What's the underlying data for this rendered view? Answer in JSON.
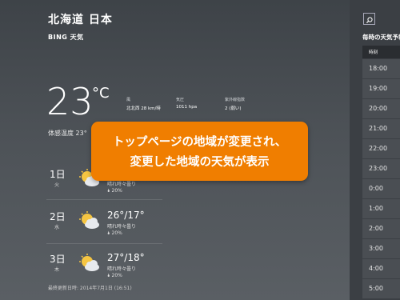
{
  "location": "北海道 日本",
  "brand": "BING 天気",
  "current": {
    "temperature": "23",
    "unit": "°C",
    "feels_like": "体感温度 23°",
    "wind_label": "風",
    "wind_value": "北北西 28 km/時",
    "pressure_label": "気圧",
    "pressure_value": "1011 hpa",
    "uv_label": "紫外線指数",
    "uv_value": "2 (弱い)"
  },
  "forecast": [
    {
      "day": "1日",
      "weekday": "火",
      "hilo": "",
      "condition": "晴れ時々曇り",
      "rain": "🌢 20%"
    },
    {
      "day": "2日",
      "weekday": "水",
      "hilo": "26°/17°",
      "condition": "晴れ時々曇り",
      "rain": "🌢 20%"
    },
    {
      "day": "3日",
      "weekday": "木",
      "hilo": "27°/18°",
      "condition": "晴れ時々曇り",
      "rain": "🌢 20%"
    }
  ],
  "updated": "最終更新日時: 2014年7月1日 (16:51)",
  "overlay": {
    "line1": "トップページの地域が変更され、",
    "line2": "変更した地域の天気が表示"
  },
  "hourly": {
    "title": "毎時の天気予報",
    "column": "時刻",
    "hours": [
      "18:00",
      "19:00",
      "20:00",
      "21:00",
      "22:00",
      "23:00",
      "0:00",
      "1:00",
      "2:00",
      "3:00",
      "4:00",
      "5:00"
    ]
  },
  "colors": {
    "accent": "#f07e00",
    "background": "#4a4f55",
    "sidebar": "#3b3f44"
  }
}
